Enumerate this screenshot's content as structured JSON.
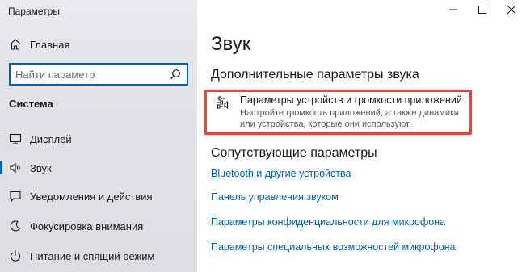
{
  "window": {
    "title": "Параметры",
    "controls": [
      "minimize-icon",
      "maximize-icon",
      "close-icon"
    ]
  },
  "sidebar": {
    "home_label": "Главная",
    "search": {
      "placeholder": "Найти параметр",
      "value": ""
    },
    "section_heading": "Система",
    "items": [
      {
        "label": "Дисплей",
        "icon": "display-icon",
        "active": false
      },
      {
        "label": "Звук",
        "icon": "speaker-icon",
        "active": true
      },
      {
        "label": "Уведомления и действия",
        "icon": "notifications-icon",
        "active": false
      },
      {
        "label": "Фокусировка внимания",
        "icon": "focus-assist-icon",
        "active": false
      },
      {
        "label": "Питание и спящий режим",
        "icon": "power-icon",
        "active": false
      }
    ]
  },
  "main": {
    "title": "Звук",
    "advanced": {
      "heading": "Дополнительные параметры звука",
      "item": {
        "title": "Параметры устройств и громкости приложений",
        "description": "Настройте громкость приложений, а также динамики или устройства, которые они используют.",
        "icon": "sliders-icon"
      }
    },
    "related": {
      "heading": "Сопутствующие параметры",
      "links": [
        "Bluetooth и другие устройства",
        "Панель управления звуком",
        "Параметры конфиденциальности для микрофона",
        "Параметры специальных возможностей микрофона"
      ]
    }
  },
  "colors": {
    "accent": "#0063b1",
    "highlight": "#e8463a",
    "sidebar_bg": "#e2e3e8"
  }
}
